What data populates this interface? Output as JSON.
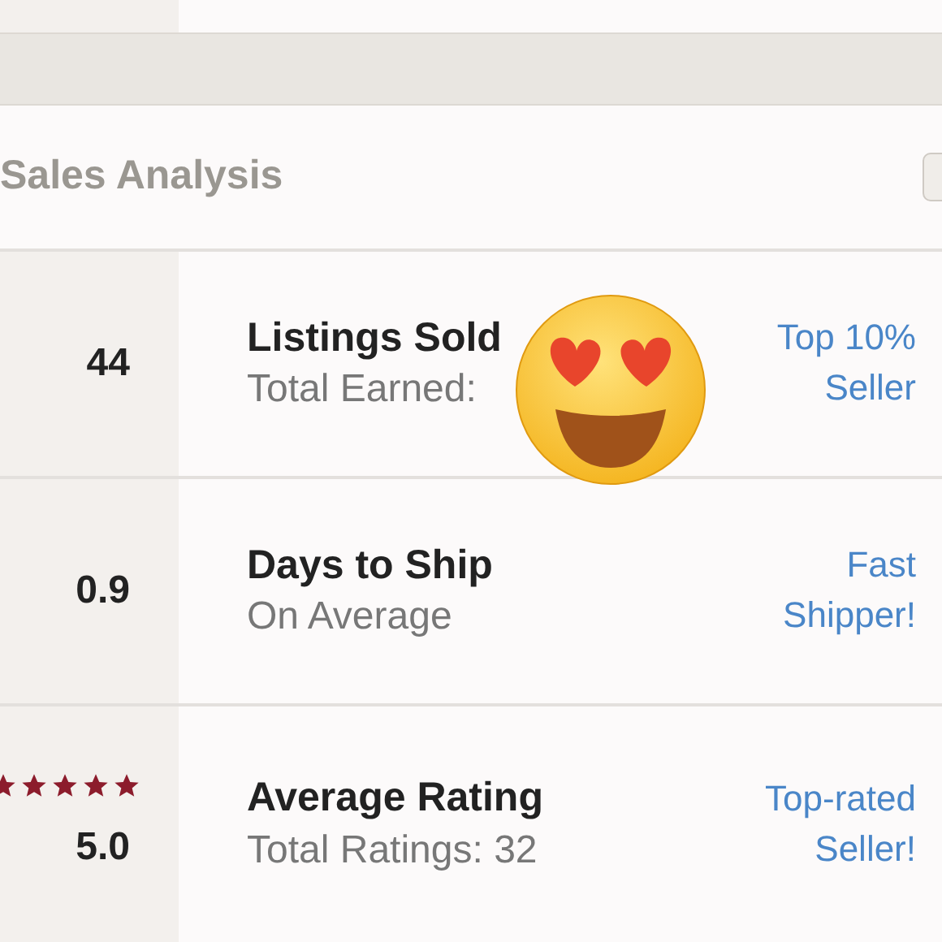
{
  "header": {
    "title": "Sales Analysis"
  },
  "stats": [
    {
      "kind": "number",
      "value": "44",
      "title": "Listings Sold",
      "subtitle": "Total Earned:",
      "badge": "Top 10% Seller"
    },
    {
      "kind": "number",
      "value": "0.9",
      "title": "Days to Ship",
      "subtitle": "On Average",
      "badge": "Fast Shipper!"
    },
    {
      "kind": "rating",
      "stars": 5,
      "value": "5.0",
      "title": "Average Rating",
      "subtitle": "Total Ratings: 32",
      "badge": "Top-rated Seller!"
    }
  ]
}
